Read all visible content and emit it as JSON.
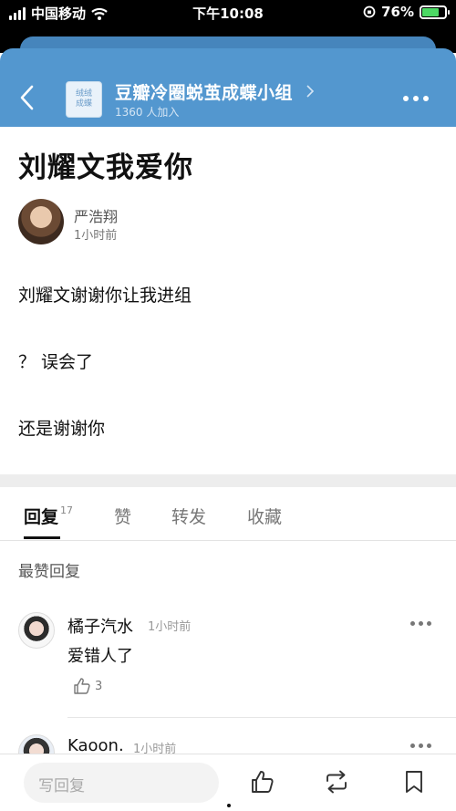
{
  "status_bar": {
    "carrier": "中国移动",
    "time": "下午10:08",
    "battery": "76%",
    "battery_level": 0.76
  },
  "header": {
    "back_icon": "chevron-left-icon",
    "group_logo_text": "绒绒\n成蝶",
    "group_name": "豆瓣冷圈蜕茧成蝶小组",
    "member_count": "1360 人加入",
    "more_icon": "ellipsis-icon"
  },
  "post": {
    "title": "刘耀文我爱你",
    "author": "严浩翔",
    "time": "1小时前",
    "paragraphs": [
      "刘耀文谢谢你让我进组",
      "？ 误会了",
      "还是谢谢你"
    ]
  },
  "tabs": [
    {
      "label": "回复",
      "count": "17",
      "active": true
    },
    {
      "label": "赞"
    },
    {
      "label": "转发"
    },
    {
      "label": "收藏"
    }
  ],
  "section_label": "最赞回复",
  "replies": [
    {
      "name": "橘子汽水",
      "time": "1小时前",
      "text": "爱错人了",
      "likes": "3"
    },
    {
      "name": "Kaoon.",
      "time": "1小时前"
    }
  ],
  "bottom_bar": {
    "reply_placeholder": "写回复",
    "icons": [
      "thumbs-up-icon",
      "repost-icon",
      "bookmark-icon"
    ]
  },
  "colors": {
    "header_blue": "#5397cf",
    "battery_green": "#4cd964"
  }
}
